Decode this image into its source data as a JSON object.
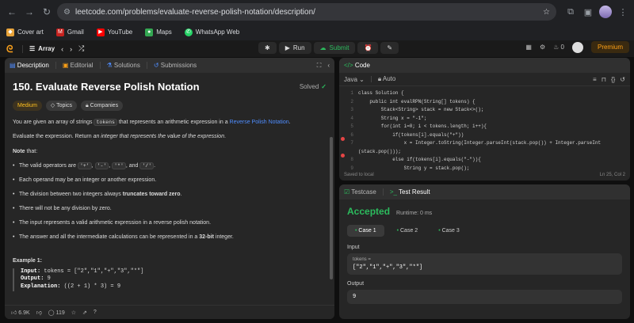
{
  "browser": {
    "url": "leetcode.com/problems/evaluate-reverse-polish-notation/description/",
    "bookmarks": [
      "Cover art",
      "Gmail",
      "YouTube",
      "Maps",
      "WhatsApp Web"
    ]
  },
  "topbar": {
    "problem_list": "Array",
    "run": "Run",
    "submit": "Submit",
    "fire_count": "0",
    "premium": "Premium"
  },
  "left": {
    "tabs": [
      "Description",
      "Editorial",
      "Solutions",
      "Submissions"
    ],
    "title": "150. Evaluate Reverse Polish Notation",
    "solved": "Solved",
    "tags": [
      "Medium",
      "Topics",
      "Companies"
    ],
    "p1a": "You are given an array of strings",
    "p1code": "tokens",
    "p1b": "that represents an arithmetic expression in a",
    "p1link": "Reverse Polish Notation",
    "p1c": ".",
    "p2a": "Evaluate the expression. Return",
    "p2b": "an integer that represents the value of the expression",
    ".": ".",
    "p2c": ".",
    "note": "Note",
    "note_suffix": "that:",
    "rule1a": "The valid operators are",
    "rule1ops": [
      "'+'",
      "'-'",
      "'*'",
      "'/'"
    ],
    "rule1sep": ",",
    "rule1and": "and",
    "rule1end": ".",
    "rule2": "Each operand may be an integer or another expression.",
    "rule3a": "The division between two integers always",
    "rule3b": "truncates toward zero",
    "rule4": "There will not be any division by zero.",
    "rule5": "The input represents a valid arithmetic expression in a reverse polish notation.",
    "rule6a": "The answer and all the intermediate calculations can be represented in a",
    "rule6b": "32-bit",
    "rule6c": "integer.",
    "example_title": "Example 1:",
    "ex_input_l": "Input:",
    "ex_input": "tokens = [\"2\",\"1\",\"+\",\"3\",\"*\"]",
    "ex_output_l": "Output:",
    "ex_output": "9",
    "ex_expl_l": "Explanation:",
    "ex_expl": "((2 + 1) * 3) = 9",
    "likes": "6.9K",
    "comments": "119"
  },
  "code": {
    "tab": "Code",
    "lang": "Java",
    "mode": "Auto",
    "saved": "Saved to local",
    "cursor": "Ln 25, Col 2",
    "lines": [
      {
        "n": "1",
        "t": "class Solution {"
      },
      {
        "n": "2",
        "t": "    public int evalRPN(String[] tokens) {"
      },
      {
        "n": "3",
        "t": "        Stack<String> stack = new Stack<>();"
      },
      {
        "n": "4",
        "t": "        String x = \"-1\";"
      },
      {
        "n": "5",
        "t": "        for(int i=0; i < tokens.length; i++){"
      },
      {
        "n": "6",
        "t": "            if(tokens[i].equals(\"+\"))"
      },
      {
        "n": "7",
        "t": "                x = Integer.toString(Integer.parseInt(stack.pop()) + Integer.parseInt"
      },
      {
        "n": "",
        "t": "(stack.pop()));"
      },
      {
        "n": "8",
        "t": "            else if(tokens[i].equals(\"-\")){"
      },
      {
        "n": "9",
        "t": "                String y = stack.pop();"
      }
    ]
  },
  "result": {
    "tabs": [
      "Testcase",
      "Test Result"
    ],
    "status": "Accepted",
    "runtime": "Runtime: 0 ms",
    "cases": [
      "Case 1",
      "Case 2",
      "Case 3"
    ],
    "input_label": "Input",
    "input_sub": "tokens =",
    "input_val": "[\"2\",\"1\",\"+\",\"3\",\"*\"]",
    "output_label": "Output",
    "output_val": "9"
  }
}
